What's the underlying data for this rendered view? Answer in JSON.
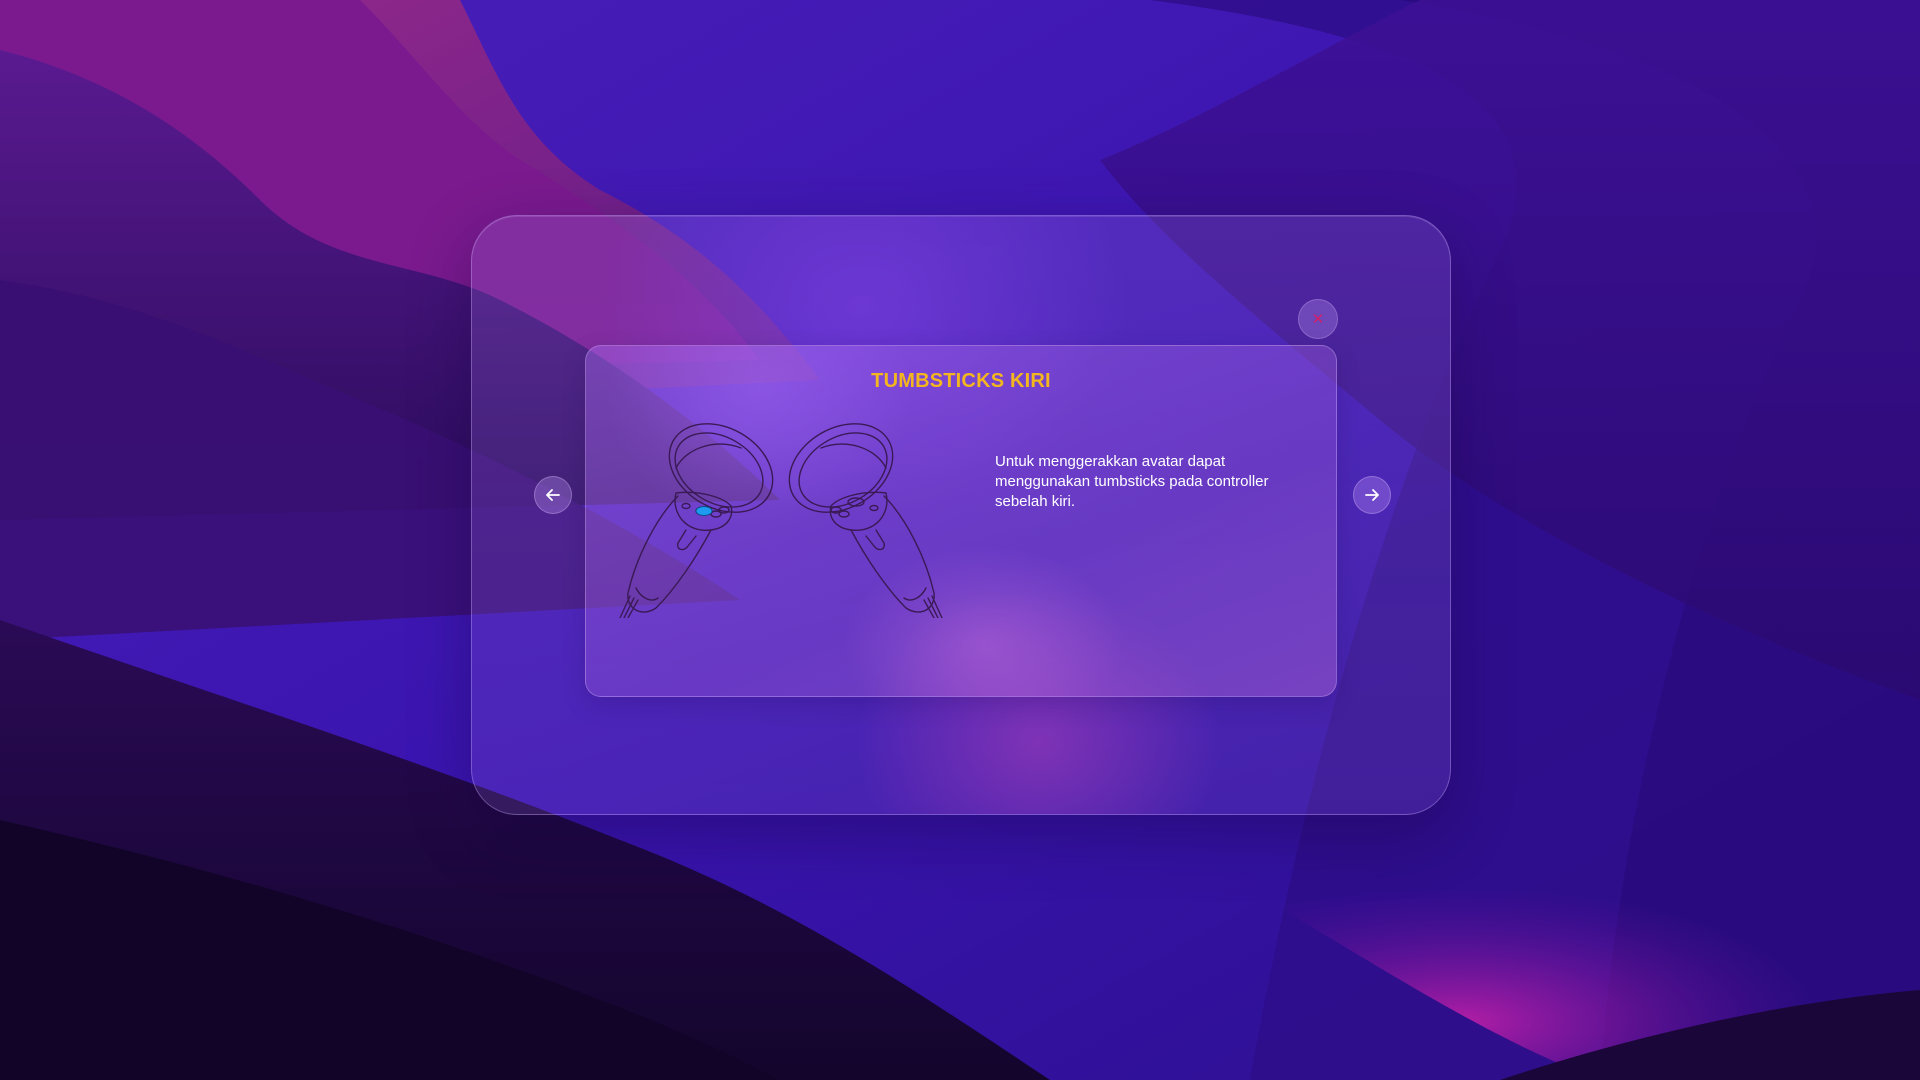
{
  "dialog": {
    "title": "TUMBSTICKS KIRI",
    "description": "Untuk menggerakkan avatar dapat menggunakan tumbsticks pada controller sebelah kiri.",
    "close_icon": "close-icon",
    "prev_icon": "arrow-left-icon",
    "next_icon": "arrow-right-icon",
    "illustration": "vr-controllers-illustration"
  },
  "colors": {
    "title": "#f3b61f",
    "description": "#ffffff",
    "close_icon": "#d0206a",
    "thumbstick_highlight": "#1e9bf0"
  }
}
